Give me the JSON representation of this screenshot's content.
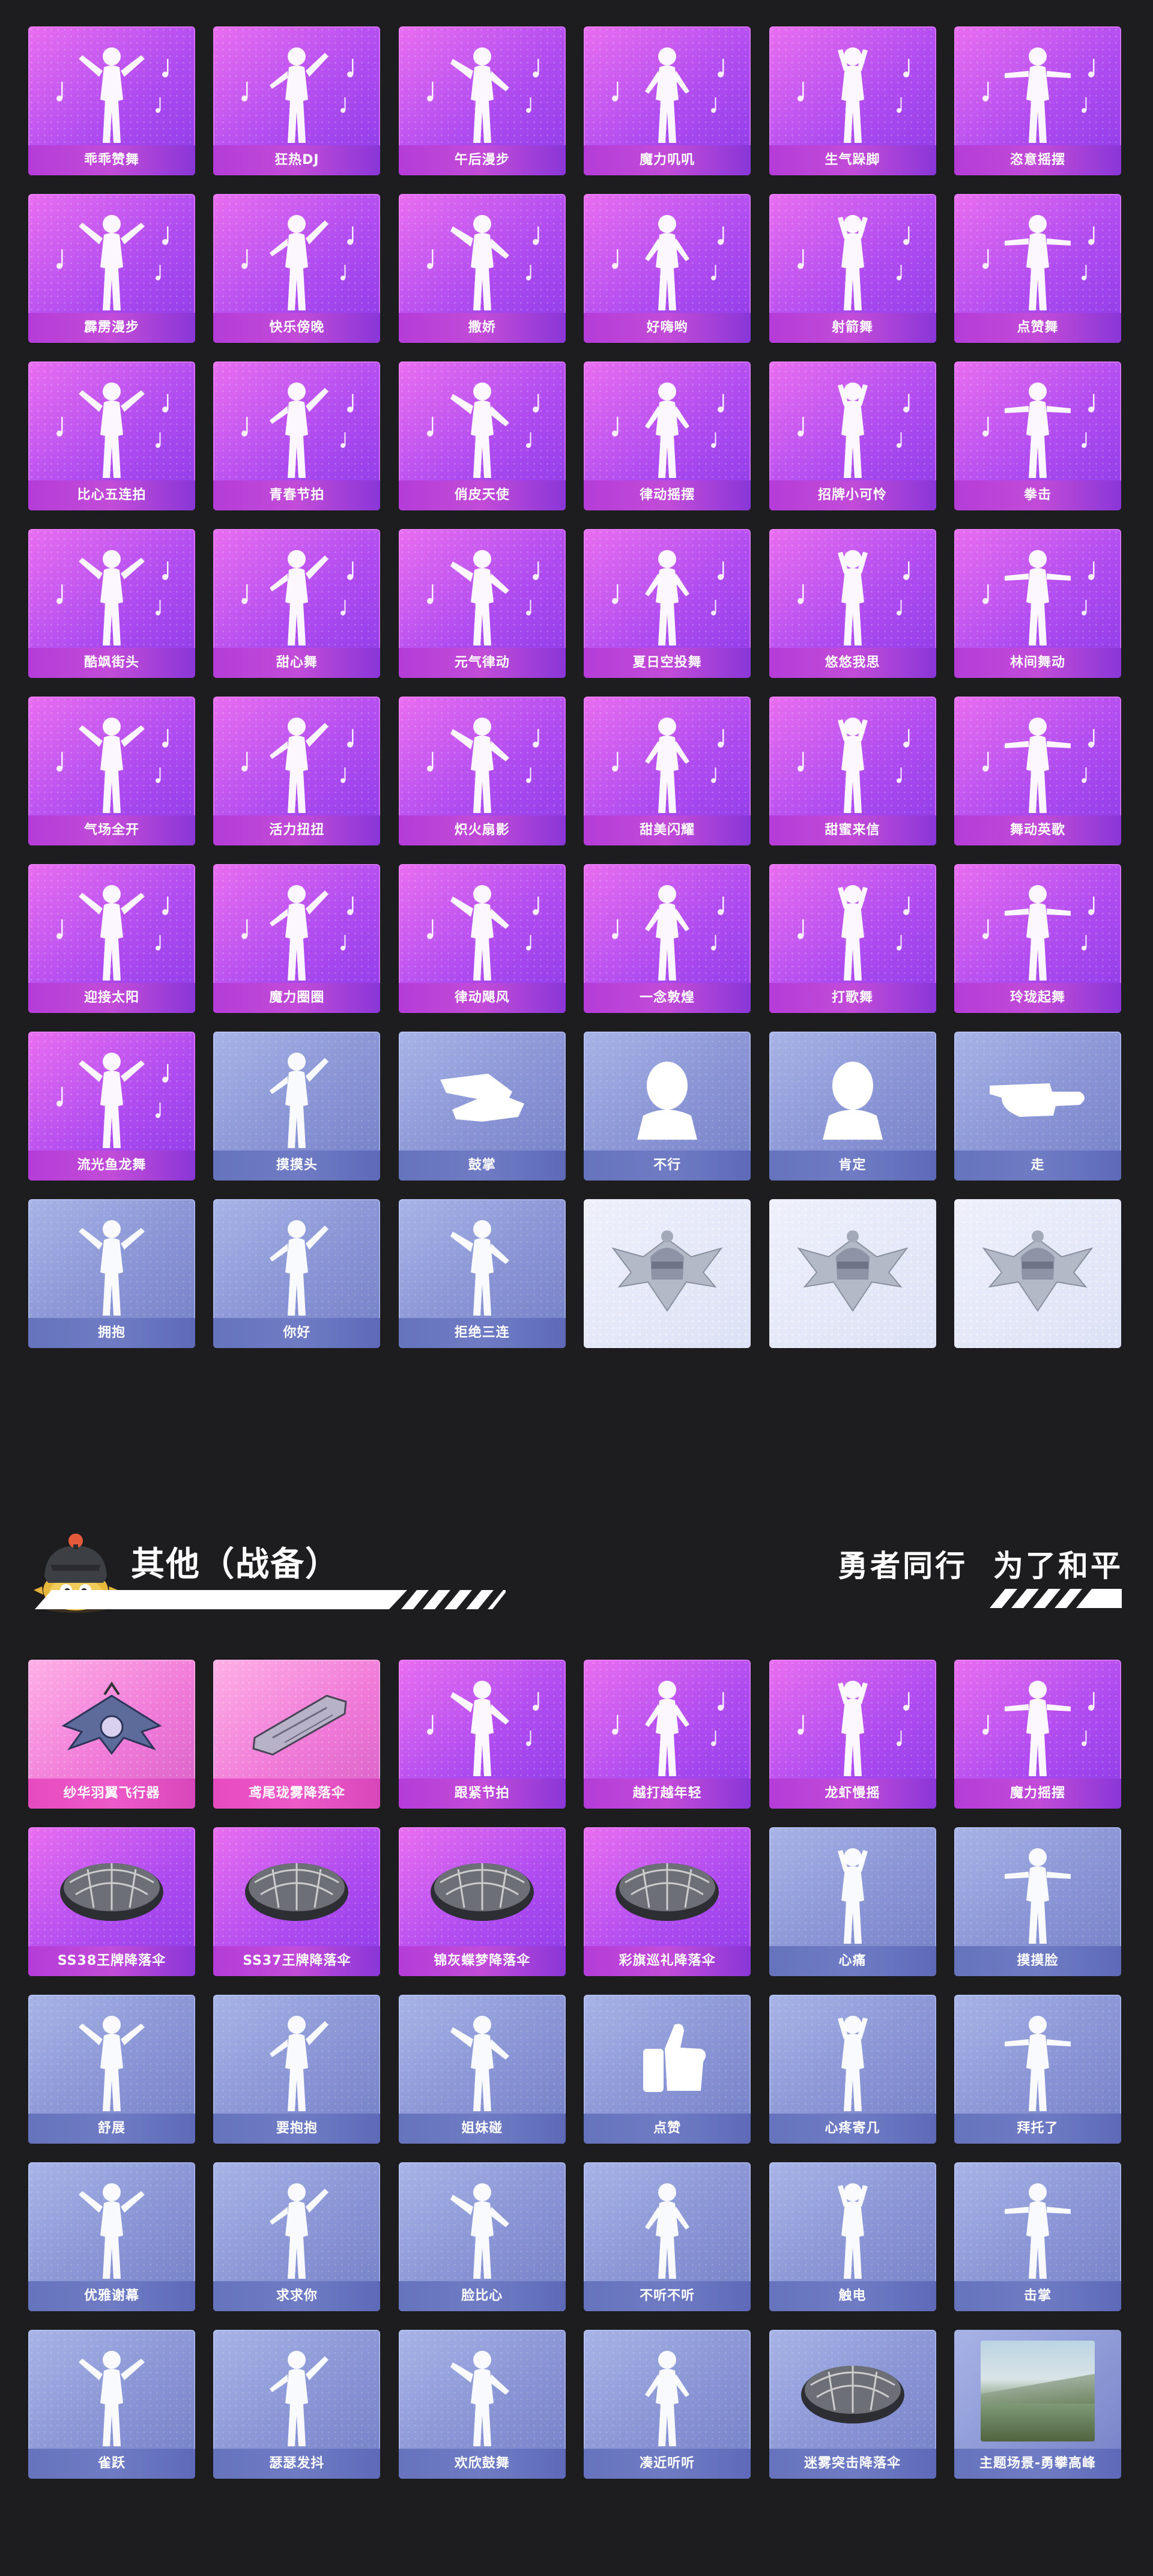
{
  "section1": {
    "items": [
      {
        "label": "乖乖赞舞",
        "type": "emote",
        "icon": "dancer-figure-icon"
      },
      {
        "label": "狂热DJ",
        "type": "emote",
        "icon": "dj-figure-icon"
      },
      {
        "label": "午后漫步",
        "type": "emote",
        "icon": "dancer-figure-icon"
      },
      {
        "label": "魔力叽叽",
        "type": "emote",
        "icon": "dancer-figure-icon"
      },
      {
        "label": "生气跺脚",
        "type": "emote",
        "icon": "dancer-figure-icon"
      },
      {
        "label": "恣意摇摆",
        "type": "emote",
        "icon": "dancer-figure-icon"
      },
      {
        "label": "霹雳漫步",
        "type": "emote",
        "icon": "dancer-figure-icon"
      },
      {
        "label": "快乐傍晚",
        "type": "emote",
        "icon": "dancer-figure-icon"
      },
      {
        "label": "撒娇",
        "type": "emote",
        "icon": "dancer-figure-icon"
      },
      {
        "label": "好嗨哟",
        "type": "emote",
        "icon": "dancer-figure-icon"
      },
      {
        "label": "射箭舞",
        "type": "emote",
        "icon": "dancer-figure-icon"
      },
      {
        "label": "点赞舞",
        "type": "emote",
        "icon": "dancer-figure-icon"
      },
      {
        "label": "比心五连拍",
        "type": "emote",
        "icon": "heart-pose-figure-icon"
      },
      {
        "label": "青春节拍",
        "type": "emote",
        "icon": "dancer-figure-icon"
      },
      {
        "label": "俏皮天使",
        "type": "emote",
        "icon": "dancer-figure-icon"
      },
      {
        "label": "律动摇摆",
        "type": "emote",
        "icon": "dancer-figure-icon"
      },
      {
        "label": "招牌小可怜",
        "type": "emote",
        "icon": "sign-holder-figure-icon"
      },
      {
        "label": "拳击",
        "type": "emote",
        "icon": "boxing-figure-icon"
      },
      {
        "label": "酷飒街头",
        "type": "emote",
        "icon": "dancer-figure-icon"
      },
      {
        "label": "甜心舞",
        "type": "emote",
        "icon": "dancer-figure-icon"
      },
      {
        "label": "元气律动",
        "type": "emote",
        "icon": "dancer-figure-icon"
      },
      {
        "label": "夏日空投舞",
        "type": "emote",
        "icon": "dancer-figure-icon"
      },
      {
        "label": "悠悠我思",
        "type": "emote",
        "icon": "dancer-figure-icon"
      },
      {
        "label": "林间舞动",
        "type": "emote",
        "icon": "dancer-figure-icon"
      },
      {
        "label": "气场全开",
        "type": "emote",
        "icon": "dancer-figure-icon"
      },
      {
        "label": "活力扭扭",
        "type": "emote",
        "icon": "dancer-figure-icon"
      },
      {
        "label": "炽火扇影",
        "type": "emote",
        "icon": "fire-fan-figure-icon"
      },
      {
        "label": "甜美闪耀",
        "type": "emote",
        "icon": "dancer-figure-icon"
      },
      {
        "label": "甜蜜来信",
        "type": "emote",
        "icon": "letter-figure-icon"
      },
      {
        "label": "舞动英歌",
        "type": "emote",
        "icon": "bubble-figure-icon"
      },
      {
        "label": "迎接太阳",
        "type": "emote",
        "icon": "dancer-figure-icon"
      },
      {
        "label": "魔力圈圈",
        "type": "emote",
        "icon": "dancer-figure-icon"
      },
      {
        "label": "律动飓风",
        "type": "emote",
        "icon": "dancer-figure-icon"
      },
      {
        "label": "一念敦煌",
        "type": "emote",
        "icon": "dancer-figure-icon"
      },
      {
        "label": "打歌舞",
        "type": "emote",
        "icon": "dancer-figure-icon"
      },
      {
        "label": "玲珑起舞",
        "type": "emote",
        "icon": "dancer-figure-icon"
      },
      {
        "label": "流光鱼龙舞",
        "type": "emote",
        "icon": "dragon-dance-figure-icon"
      },
      {
        "label": "摸摸头",
        "type": "basic",
        "icon": "pat-head-figure-icon"
      },
      {
        "label": "鼓掌",
        "type": "basic",
        "icon": "clapping-hands-icon"
      },
      {
        "label": "不行",
        "type": "basic",
        "icon": "head-shake-icon"
      },
      {
        "label": "肯定",
        "type": "basic",
        "icon": "head-nod-icon"
      },
      {
        "label": "走",
        "type": "basic",
        "icon": "pointing-hand-icon"
      },
      {
        "label": "拥抱",
        "type": "basic",
        "icon": "hug-figure-icon"
      },
      {
        "label": "你好",
        "type": "basic",
        "icon": "wave-figure-icon"
      },
      {
        "label": "拒绝三连",
        "type": "basic",
        "icon": "cross-arms-figure-icon"
      },
      {
        "label": "",
        "type": "empty",
        "icon": "pubg-badge-icon"
      },
      {
        "label": "",
        "type": "empty",
        "icon": "pubg-badge-icon"
      },
      {
        "label": "",
        "type": "empty",
        "icon": "pubg-badge-icon"
      }
    ]
  },
  "section_header": {
    "title": "其他（战备）",
    "slogan": "勇者同行  为了和平",
    "mascot_icon": "helmet-mascot-icon"
  },
  "section2": {
    "items": [
      {
        "label": "纱华羽翼飞行器",
        "type": "item",
        "icon": "wing-glider-icon"
      },
      {
        "label": "鸢尾珑雾降落伞",
        "type": "item",
        "icon": "parachute-pack-icon"
      },
      {
        "label": "跟紧节拍",
        "type": "emote",
        "icon": "dancer-figure-icon"
      },
      {
        "label": "越打越年轻",
        "type": "emote",
        "icon": "dancer-figure-icon"
      },
      {
        "label": "龙虾慢摇",
        "type": "emote",
        "icon": "dancer-figure-icon"
      },
      {
        "label": "魔力摇摆",
        "type": "emote",
        "icon": "dancer-figure-icon"
      },
      {
        "label": "SS38王牌降落伞",
        "type": "emote",
        "icon": "parachute-canopy-icon"
      },
      {
        "label": "SS37王牌降落伞",
        "type": "emote",
        "icon": "parachute-canopy-icon"
      },
      {
        "label": "锦灰蝶梦降落伞",
        "type": "emote",
        "icon": "parachute-canopy-icon"
      },
      {
        "label": "彩旗巡礼降落伞",
        "type": "emote",
        "icon": "parachute-canopy-icon"
      },
      {
        "label": "心痛",
        "type": "basic",
        "icon": "heartache-figure-icon"
      },
      {
        "label": "摸摸脸",
        "type": "basic",
        "icon": "touch-face-figure-icon"
      },
      {
        "label": "舒展",
        "type": "basic",
        "icon": "stretch-figure-icon"
      },
      {
        "label": "要抱抱",
        "type": "basic",
        "icon": "hug-request-figure-icon"
      },
      {
        "label": "姐妹碰",
        "type": "basic",
        "icon": "hip-bump-figure-icon"
      },
      {
        "label": "点赞",
        "type": "basic",
        "icon": "thumbs-up-icon"
      },
      {
        "label": "心疼寄几",
        "type": "basic",
        "icon": "self-hug-figure-icon"
      },
      {
        "label": "拜托了",
        "type": "basic",
        "icon": "pray-figure-icon"
      },
      {
        "label": "优雅谢幕",
        "type": "basic",
        "icon": "bow-figure-icon"
      },
      {
        "label": "求求你",
        "type": "basic",
        "icon": "beg-figure-icon"
      },
      {
        "label": "脸比心",
        "type": "basic",
        "icon": "face-heart-figure-icon"
      },
      {
        "label": "不听不听",
        "type": "basic",
        "icon": "cover-ears-figure-icon"
      },
      {
        "label": "触电",
        "type": "basic",
        "icon": "shock-figure-icon"
      },
      {
        "label": "击掌",
        "type": "basic",
        "icon": "high-five-figure-icon"
      },
      {
        "label": "雀跃",
        "type": "basic",
        "icon": "cheer-figure-icon"
      },
      {
        "label": "瑟瑟发抖",
        "type": "basic",
        "icon": "shiver-figure-icon"
      },
      {
        "label": "欢欣鼓舞",
        "type": "basic",
        "icon": "celebrate-figure-icon"
      },
      {
        "label": "凑近听听",
        "type": "basic",
        "icon": "listen-figure-icon"
      },
      {
        "label": "迷雾突击降落伞",
        "type": "basic",
        "icon": "parachute-canopy-icon"
      },
      {
        "label": "主题场景-勇攀高峰",
        "type": "scene",
        "icon": "mountain-scene-icon"
      }
    ]
  },
  "colors": {
    "page_background": "#1d1d1f",
    "emote_card": "#b04cf0",
    "basic_card": "#8894d4",
    "item_card": "#f07ad8",
    "empty_card": "#dde1f5",
    "label_text": "#ffffff"
  }
}
